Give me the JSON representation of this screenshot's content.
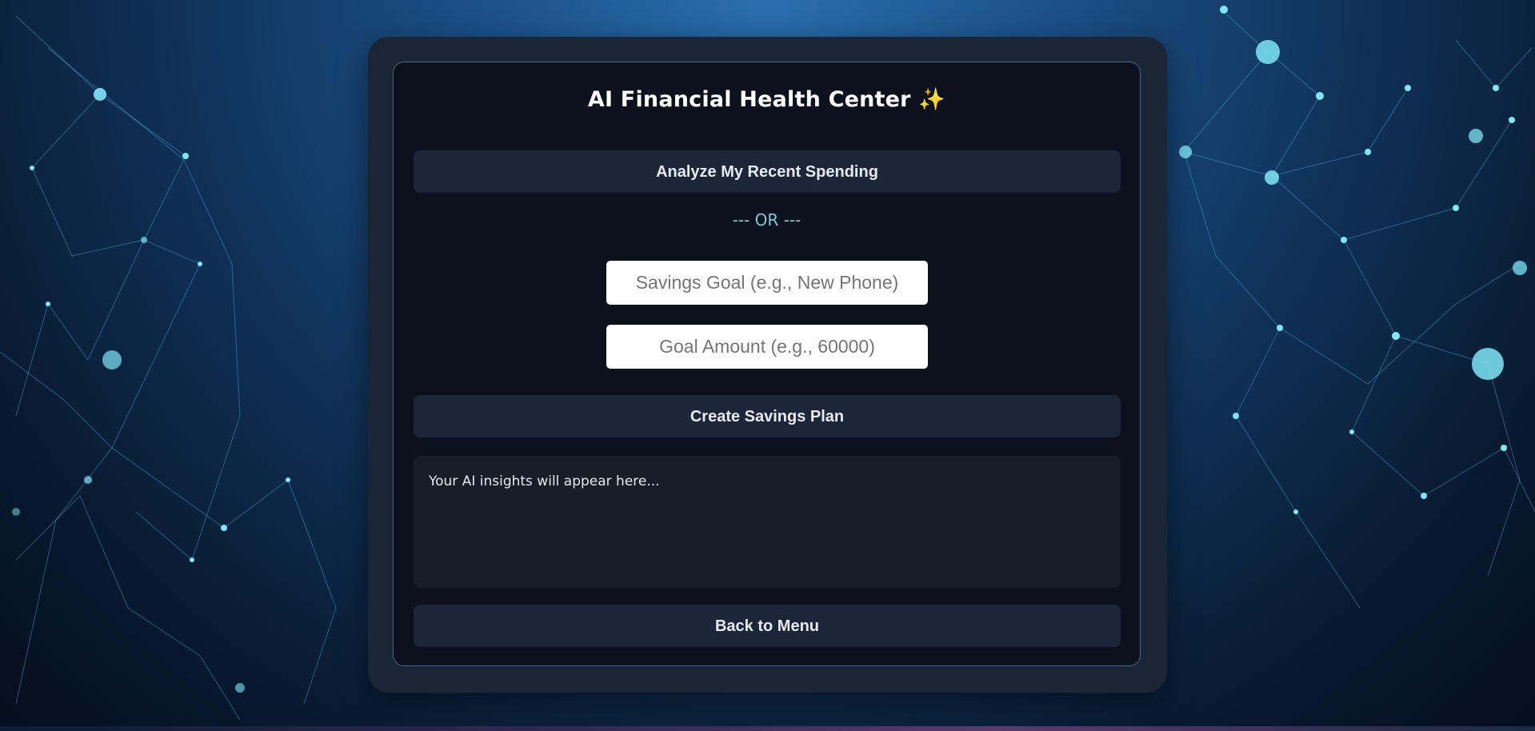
{
  "app": {
    "title": "AI Financial Health Center",
    "title_emoji": "✨"
  },
  "actions": {
    "analyze_label": "Analyze My Recent Spending",
    "separator": "--- OR ---",
    "create_plan_label": "Create Savings Plan",
    "back_label": "Back to Menu"
  },
  "form": {
    "goal_name": {
      "value": "",
      "placeholder": "Savings Goal (e.g., New Phone)"
    },
    "goal_amount": {
      "value": "",
      "placeholder": "Goal Amount (e.g., 60000)"
    }
  },
  "output": {
    "text": "Your AI insights will appear here..."
  },
  "theme": {
    "card_outer": "#1a2535",
    "card_inner": "#0b111d",
    "button_bg": "#1c2638",
    "separator_color": "#86c6d8",
    "sparkle_color": "#f5b84a",
    "network_glow": "#4fd9f0"
  },
  "icons": {
    "title_icon": "sparkles-icon"
  }
}
